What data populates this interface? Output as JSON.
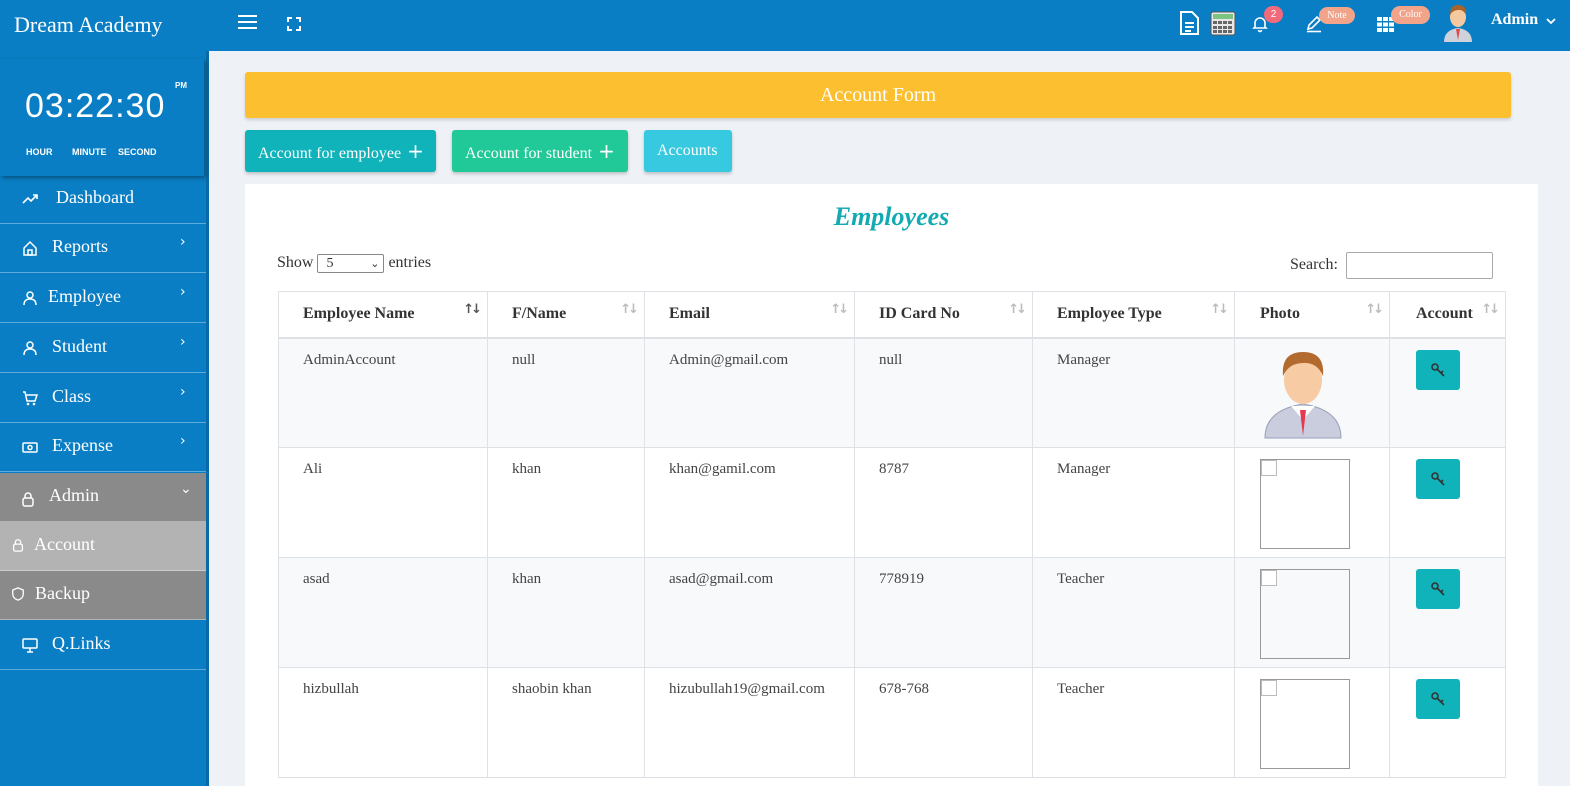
{
  "app": {
    "brand": "Dream Academy",
    "user": "Admin",
    "notification_count": "2",
    "note_label": "Note",
    "color_label": "Color"
  },
  "clock": {
    "time": "03:22:30",
    "ampm": "PM",
    "hour_label": "HOUR",
    "minute_label": "MINUTE",
    "second_label": "SECOND"
  },
  "sidebar": {
    "items": [
      {
        "label": "Dashboard",
        "icon": "trending-up-icon"
      },
      {
        "label": "Reports",
        "icon": "home-icon"
      },
      {
        "label": "Employee",
        "icon": "user-icon"
      },
      {
        "label": "Student",
        "icon": "user-icon"
      },
      {
        "label": "Class",
        "icon": "cart-icon"
      },
      {
        "label": "Expense",
        "icon": "money-icon"
      },
      {
        "label": "Admin",
        "icon": "lock-icon"
      },
      {
        "label": "Account",
        "icon": "lock-icon"
      },
      {
        "label": "Backup",
        "icon": "shield-icon"
      },
      {
        "label": "Q.Links",
        "icon": "monitor-icon"
      }
    ],
    "chevron": "›",
    "chevron_down": "⌄"
  },
  "main": {
    "header": "Account Form",
    "buttons": {
      "employee": "Account for employee",
      "student": "Account for student",
      "accounts": "Accounts",
      "plus": "+"
    },
    "title": "Employees",
    "show_label": "Show",
    "entries_value": "5",
    "entries_label": "entries",
    "search_label": "Search:",
    "columns": [
      "Employee Name",
      "F/Name",
      "Email",
      "ID Card No",
      "Employee Type",
      "Photo",
      "Account"
    ],
    "rows": [
      {
        "name": "AdminAccount",
        "fname": "null",
        "email": "Admin@gmail.com",
        "id": "null",
        "type": "Manager"
      },
      {
        "name": "Ali",
        "fname": "khan",
        "email": "khan@gamil.com",
        "id": "8787",
        "type": "Manager"
      },
      {
        "name": "asad",
        "fname": "khan",
        "email": "asad@gmail.com",
        "id": "778919",
        "type": "Teacher"
      },
      {
        "name": "hizbullah",
        "fname": "shaobin khan",
        "email": "hizubullah19@gmail.com",
        "id": "678-768",
        "type": "Teacher"
      }
    ]
  },
  "colors": {
    "primary": "#0a7ec4",
    "header": "#fbbf2f",
    "teal": "#10b3ba",
    "green": "#20c997",
    "cyan": "#36c9df"
  }
}
